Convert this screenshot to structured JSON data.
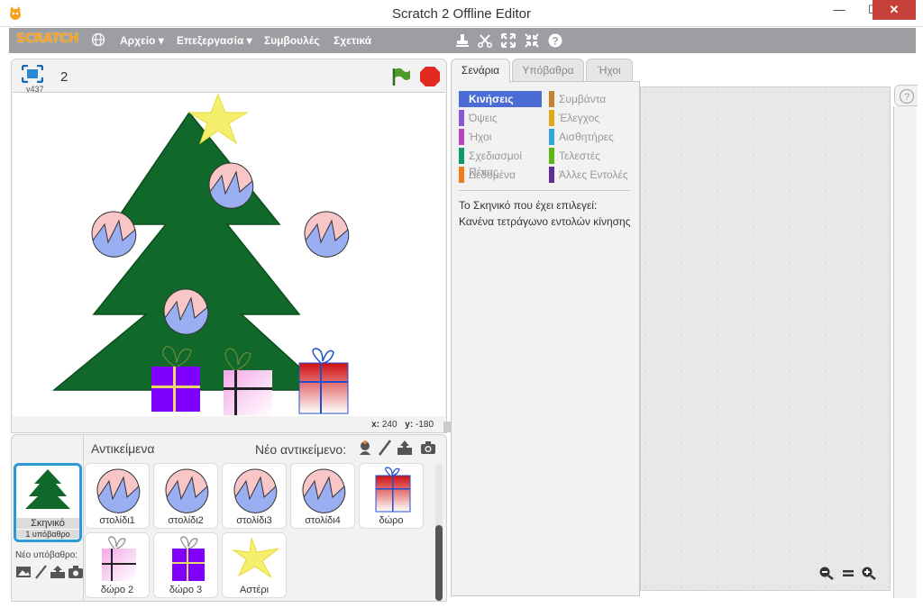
{
  "window": {
    "title": "Scratch 2 Offline Editor",
    "minimize": "—",
    "maximize": "☐",
    "close": "✕"
  },
  "menubar": {
    "logo": "SCRATCH",
    "items": [
      "Αρχείο ▾",
      "Επεξεργασία ▾",
      "Συμβουλές",
      "Σχετικά"
    ]
  },
  "stage": {
    "version": "v437",
    "project_number": "2",
    "coords": {
      "x_label": "x:",
      "x": "240",
      "y_label": "y:",
      "y": "-180"
    }
  },
  "sprites": {
    "title": "Αντικείμενα",
    "new_sprite_label": "Νέο αντικείμενο:",
    "stage_tile": {
      "label": "Σκηνικό",
      "sub": "1 υπόβαθρο"
    },
    "new_backdrop_label": "Νέο υπόβαθρο:",
    "items": [
      "στολίδι1",
      "στολίδι2",
      "στολίδι3",
      "στολίδι4",
      "δώρο",
      "δώρο 2",
      "δώρο 3",
      "Αστέρι"
    ]
  },
  "tabs": [
    "Σενάρια",
    "Υπόβαθρα",
    "Ήχοι"
  ],
  "categories": [
    {
      "label": "Κινήσεις",
      "color": "#4a6cd4",
      "active": true
    },
    {
      "label": "Συμβάντα",
      "color": "#c88330"
    },
    {
      "label": "Όψεις",
      "color": "#8a55d7"
    },
    {
      "label": "Έλεγχος",
      "color": "#e1a91a"
    },
    {
      "label": "Ήχοι",
      "color": "#bb42c3"
    },
    {
      "label": "Αισθητήρες",
      "color": "#2ca5e2"
    },
    {
      "label": "Σχεδιασμοί Πένας",
      "color": "#0e9a6c"
    },
    {
      "label": "Τελεστές",
      "color": "#5cb712"
    },
    {
      "label": "Δεδομένα",
      "color": "#ee7d16"
    },
    {
      "label": "Άλλες Εντολές",
      "color": "#632d99"
    }
  ],
  "motion_message": {
    "line1": "Το Σκηνικό που έχει επιλεγεί:",
    "line2": "Κανένα τετράγωνο εντολών κίνησης"
  },
  "help_icon": "?"
}
